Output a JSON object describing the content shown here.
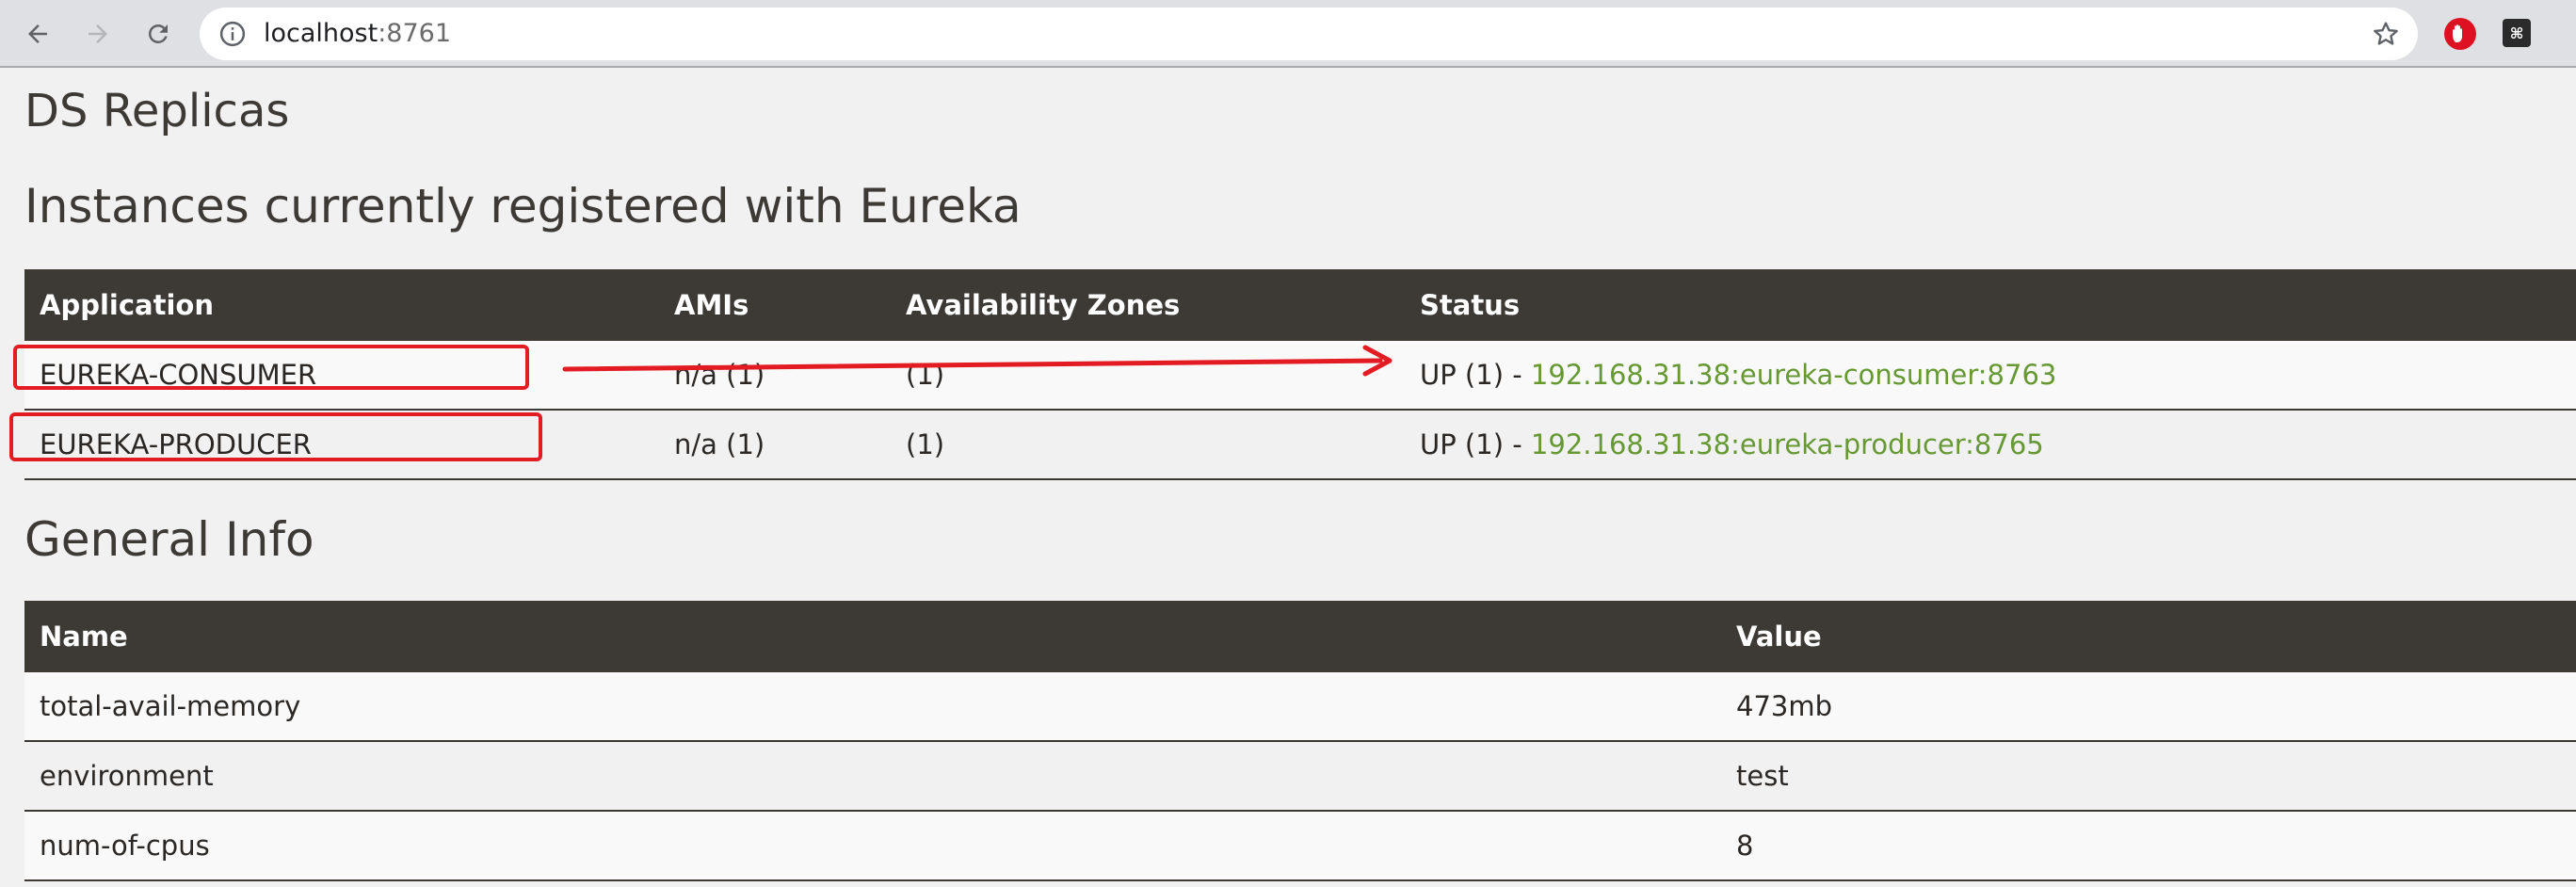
{
  "browser": {
    "url_host": "localhost",
    "url_port": ":8761"
  },
  "page": {
    "title": "DS Replicas",
    "instances_heading": "Instances currently registered with Eureka",
    "general_heading": "General Info"
  },
  "instances": {
    "columns": [
      "Application",
      "AMIs",
      "Availability Zones",
      "Status"
    ],
    "rows": [
      {
        "application": "EUREKA-CONSUMER",
        "amis": "n/a (1)",
        "zones": "(1)",
        "status_prefix": "UP (1) - ",
        "status_link": "192.168.31.38:eureka-consumer:8763"
      },
      {
        "application": "EUREKA-PRODUCER",
        "amis": "n/a (1)",
        "zones": "(1)",
        "status_prefix": "UP (1) - ",
        "status_link": "192.168.31.38:eureka-producer:8765"
      }
    ]
  },
  "general": {
    "columns": [
      "Name",
      "Value"
    ],
    "rows": [
      {
        "name": "total-avail-memory",
        "value": "473mb"
      },
      {
        "name": "environment",
        "value": "test"
      },
      {
        "name": "num-of-cpus",
        "value": "8"
      }
    ]
  },
  "colors": {
    "header_bg": "#3d3935",
    "link": "#669933",
    "annotation": "#e31b23"
  }
}
